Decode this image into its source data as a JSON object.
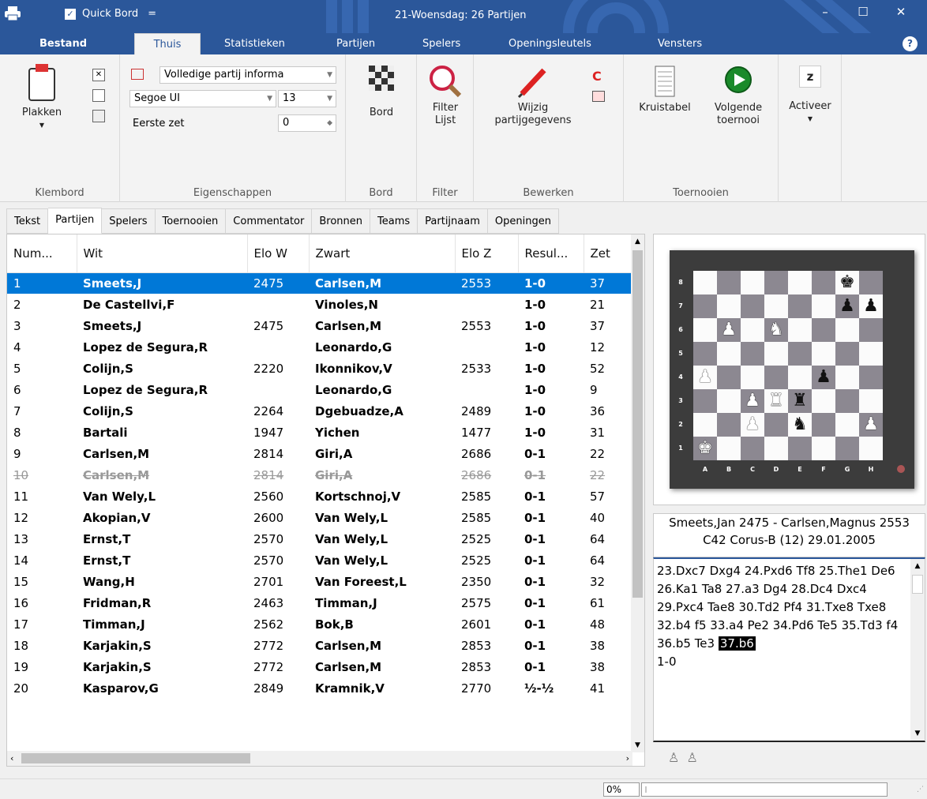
{
  "titlebar": {
    "quick_label": "Quick Bord",
    "quick_arrow": "=",
    "title": "21-Woensdag:  26 Partijen",
    "min": "–",
    "max": "☐",
    "close": "✕"
  },
  "menu": {
    "items": [
      "Bestand",
      "Thuis",
      "Statistieken",
      "Partijen",
      "Spelers",
      "Openingsleutels",
      "Vensters"
    ],
    "active": "Thuis",
    "help": "?"
  },
  "ribbon": {
    "klembord": {
      "paste": "Plakken",
      "group": "Klembord"
    },
    "eigenschappen": {
      "info_combo": "Volledige partij informa",
      "font_combo": "Segoe UI",
      "size_combo": "13",
      "eerste_zet_label": "Eerste zet",
      "eerste_zet_value": "0",
      "group": "Eigenschappen"
    },
    "bord": {
      "button": "Bord",
      "group": "Bord"
    },
    "filter": {
      "button_line1": "Filter",
      "button_line2": "Lijst",
      "group": "Filter"
    },
    "bewerken": {
      "button_line1": "Wijzig",
      "button_line2": "partijgegevens",
      "group": "Bewerken"
    },
    "toernooien": {
      "kruistabel": "Kruistabel",
      "volgende_line1": "Volgende",
      "volgende_line2": "toernooi",
      "group": "Toernooien"
    },
    "activeer": {
      "button": "Activeer"
    }
  },
  "panel_tabs": [
    "Tekst",
    "Partijen",
    "Spelers",
    "Toernooien",
    "Commentator",
    "Bronnen",
    "Teams",
    "Partijnaam",
    "Openingen"
  ],
  "panel_tab_active": "Partijen",
  "games": {
    "columns": [
      "Num...",
      "Wit",
      "Elo W",
      "Zwart",
      "Elo Z",
      "Resul...",
      "Zet"
    ],
    "rows": [
      [
        "1",
        "Smeets,J",
        "2475",
        "Carlsen,M",
        "2553",
        "1-0",
        "37"
      ],
      [
        "2",
        "De Castellvi,F",
        "",
        "Vinoles,N",
        "",
        "1-0",
        "21"
      ],
      [
        "3",
        "Smeets,J",
        "2475",
        "Carlsen,M",
        "2553",
        "1-0",
        "37"
      ],
      [
        "4",
        "Lopez de Segura,R",
        "",
        "Leonardo,G",
        "",
        "1-0",
        "12"
      ],
      [
        "5",
        "Colijn,S",
        "2220",
        "Ikonnikov,V",
        "2533",
        "1-0",
        "52"
      ],
      [
        "6",
        "Lopez de Segura,R",
        "",
        "Leonardo,G",
        "",
        "1-0",
        "9"
      ],
      [
        "7",
        "Colijn,S",
        "2264",
        "Dgebuadze,A",
        "2489",
        "1-0",
        "36"
      ],
      [
        "8",
        "Bartali",
        "1947",
        "Yichen",
        "1477",
        "1-0",
        "31"
      ],
      [
        "9",
        "Carlsen,M",
        "2814",
        "Giri,A",
        "2686",
        "0-1",
        "22"
      ],
      [
        "10",
        "Carlsen,M",
        "2814",
        "Giri,A",
        "2686",
        "0-1",
        "22"
      ],
      [
        "11",
        "Van Wely,L",
        "2560",
        "Kortschnoj,V",
        "2585",
        "0-1",
        "57"
      ],
      [
        "12",
        "Akopian,V",
        "2600",
        "Van Wely,L",
        "2585",
        "0-1",
        "40"
      ],
      [
        "13",
        "Ernst,T",
        "2570",
        "Van Wely,L",
        "2525",
        "0-1",
        "64"
      ],
      [
        "14",
        "Ernst,T",
        "2570",
        "Van Wely,L",
        "2525",
        "0-1",
        "64"
      ],
      [
        "15",
        "Wang,H",
        "2701",
        "Van Foreest,L",
        "2350",
        "0-1",
        "32"
      ],
      [
        "16",
        "Fridman,R",
        "2463",
        "Timman,J",
        "2575",
        "0-1",
        "61"
      ],
      [
        "17",
        "Timman,J",
        "2562",
        "Bok,B",
        "2601",
        "0-1",
        "48"
      ],
      [
        "18",
        "Karjakin,S",
        "2772",
        "Carlsen,M",
        "2853",
        "0-1",
        "38"
      ],
      [
        "19",
        "Karjakin,S",
        "2772",
        "Carlsen,M",
        "2853",
        "0-1",
        "38"
      ],
      [
        "20",
        "Kasparov,G",
        "2849",
        "Kramnik,V",
        "2770",
        "½-½",
        "41"
      ]
    ],
    "selected_row": 0,
    "deleted_row": 9
  },
  "board": {
    "ranks": [
      "8",
      "7",
      "6",
      "5",
      "4",
      "3",
      "2",
      "1"
    ],
    "files": [
      "A",
      "B",
      "C",
      "D",
      "E",
      "F",
      "G",
      "H"
    ],
    "position": [
      [
        "",
        "",
        "",
        "",
        "",
        "",
        "bk",
        ""
      ],
      [
        "",
        "",
        "",
        "",
        "",
        "",
        "bp",
        "bp"
      ],
      [
        "",
        "wp",
        "",
        "wn",
        "",
        "",
        "",
        ""
      ],
      [
        "",
        "",
        "",
        "",
        "",
        "",
        "",
        ""
      ],
      [
        "wp",
        "",
        "",
        "",
        "",
        "bp",
        "",
        ""
      ],
      [
        "",
        "",
        "wp",
        "wr",
        "br",
        "",
        "",
        ""
      ],
      [
        "",
        "",
        "wp",
        "",
        "bn",
        "",
        "",
        "wp"
      ],
      [
        "wk",
        "",
        "",
        "",
        "",
        "",
        "",
        ""
      ]
    ]
  },
  "game_info": {
    "line1": "Smeets,Jan 2475 - Carlsen,Magnus 2553",
    "line2": "C42 Corus-B (12) 29.01.2005"
  },
  "notation": {
    "text": "23.Dxc7 Dxg4 24.Pxd6 Tf8 25.The1 De6 26.Ka1 Ta8 27.a3 Dg4 28.Dc4 Dxc4 29.Pxc4 Tae8 30.Td2 Pf4 31.Txe8 Txe8 32.b4 f5 33.a4 Pe2 34.Pd6 Te5 35.Td3 f4 36.b5 Te3",
    "current_move": "37.b6",
    "result": "1-0"
  },
  "status": {
    "percent": "0%",
    "progress": 0
  }
}
